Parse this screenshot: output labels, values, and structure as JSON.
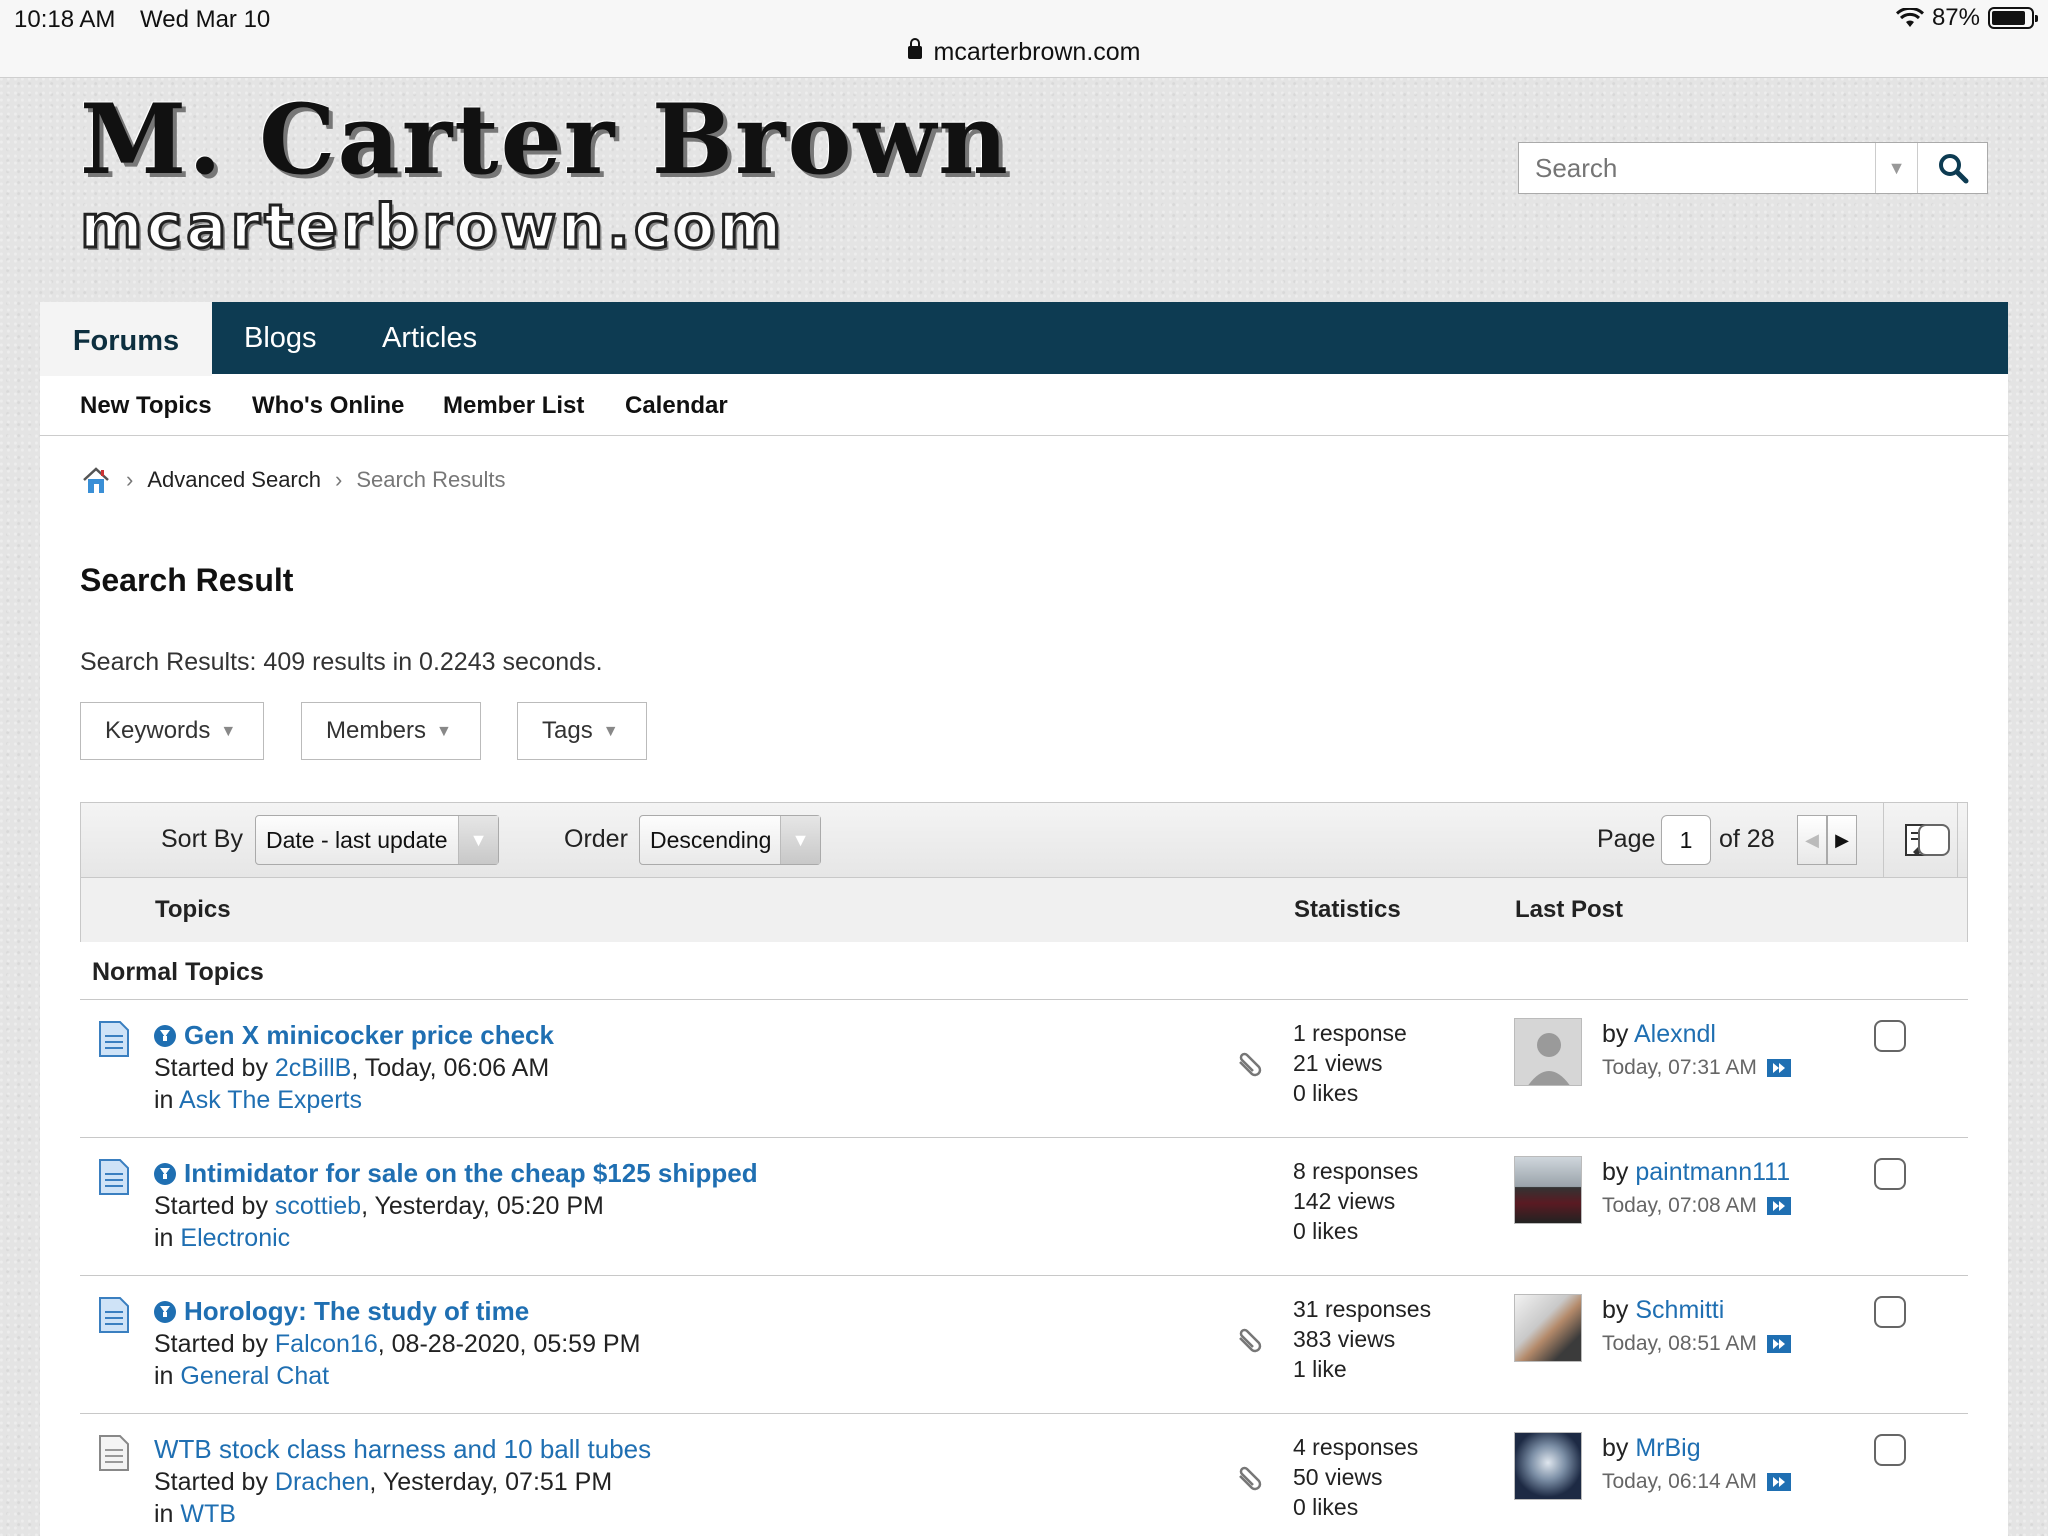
{
  "status_bar": {
    "time": "10:18 AM",
    "date": "Wed Mar 10",
    "url": "mcarterbrown.com",
    "battery": "87%"
  },
  "logo": {
    "main": "M. Carter Brown",
    "sub": "mcarterbrown.com"
  },
  "header_search": {
    "placeholder": "Search"
  },
  "top_nav": {
    "tabs": [
      "Forums",
      "Blogs",
      "Articles"
    ],
    "active": "Forums"
  },
  "sub_nav": [
    "New Topics",
    "Who's Online",
    "Member List",
    "Calendar"
  ],
  "breadcrumb": [
    "Advanced Search",
    "Search Results"
  ],
  "page_title": "Search Result",
  "summary": "Search Results: 409 results in 0.2243 seconds.",
  "filters": [
    "Keywords",
    "Members",
    "Tags"
  ],
  "toolbar": {
    "sort_label": "Sort By",
    "sort_value": "Date - last update",
    "order_label": "Order",
    "order_value": "Descending",
    "page_label": "Page",
    "page_value": "1",
    "page_of": "of 28"
  },
  "columns": {
    "topics": "Topics",
    "statistics": "Statistics",
    "last_post": "Last Post"
  },
  "section_label": "Normal Topics",
  "rows": [
    {
      "title": "Gen X minicocker price check",
      "started_prefix": "Started by ",
      "author": "2cBillB",
      "started_when": ", Today, 06:06 AM",
      "in_prefix": "in ",
      "forum": "Ask The Experts",
      "responses": "1 response",
      "views": "21 views",
      "likes": "0 likes",
      "last_by_prefix": "by ",
      "last_by": "Alexndl",
      "last_when": "Today, 07:31 AM"
    },
    {
      "title": "Intimidator for sale on the cheap $125 shipped",
      "started_prefix": "Started by ",
      "author": "scottieb",
      "started_when": ", Yesterday, 05:20 PM",
      "in_prefix": "in ",
      "forum": "Electronic",
      "responses": "8 responses",
      "views": "142 views",
      "likes": "0 likes",
      "last_by_prefix": "by ",
      "last_by": "paintmann111",
      "last_when": "Today, 07:08 AM"
    },
    {
      "title": "Horology: The study of time",
      "started_prefix": "Started by ",
      "author": "Falcon16",
      "started_when": ", 08-28-2020, 05:59 PM",
      "in_prefix": "in ",
      "forum": "General Chat",
      "responses": "31 responses",
      "views": "383 views",
      "likes": "1 like",
      "last_by_prefix": "by ",
      "last_by": "Schmitti",
      "last_when": "Today, 08:51 AM"
    },
    {
      "title": "WTB stock class harness and 10 ball tubes",
      "started_prefix": "Started by ",
      "author": "Drachen",
      "started_when": ", Yesterday, 07:51 PM",
      "in_prefix": "in ",
      "forum": "WTB",
      "responses": "4 responses",
      "views": "50 views",
      "likes": "0 likes",
      "last_by_prefix": "by ",
      "last_by": "MrBig",
      "last_when": "Today, 06:14 AM"
    }
  ],
  "colors": {
    "nav_bg": "#0d3b52",
    "link": "#1f6fb2"
  }
}
